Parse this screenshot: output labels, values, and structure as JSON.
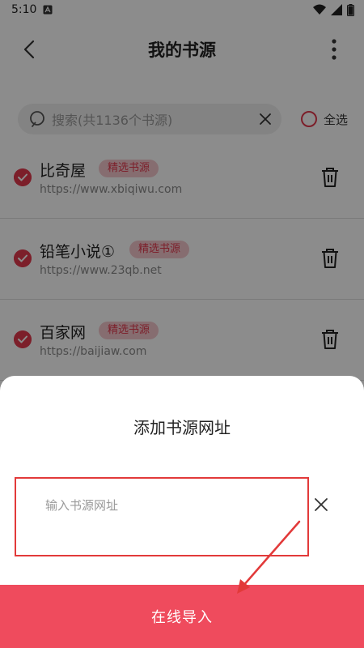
{
  "status_bar": {
    "time": "5:10",
    "icons": [
      "notification-a-icon",
      "wifi-icon",
      "signal-icon",
      "battery-icon"
    ]
  },
  "app_bar": {
    "title": "我的书源",
    "back_icon": "chevron-left-icon",
    "menu_icon": "more-vertical-icon"
  },
  "search": {
    "placeholder": "搜索(共1136个书源)",
    "clear_icon": "close-icon"
  },
  "select_all_label": "全选",
  "sources": [
    {
      "name": "比奇屋",
      "badge": "精选书源",
      "url": "https://www.xbiqiwu.com",
      "checked": true
    },
    {
      "name": "铅笔小说①",
      "badge": "精选书源",
      "url": "https://www.23qb.net",
      "checked": true
    },
    {
      "name": "百家网",
      "badge": "精选书源",
      "url": "https://baijiaw.com",
      "checked": true
    }
  ],
  "sheet": {
    "title": "添加书源网址",
    "input_placeholder": "输入书源网址",
    "input_value": "",
    "import_label": "在线导入"
  },
  "colors": {
    "accent": "#e2394e",
    "badge_bg": "#f5c6cc",
    "import_button": "#ef4b5d",
    "highlight_border": "#e23a3a"
  }
}
